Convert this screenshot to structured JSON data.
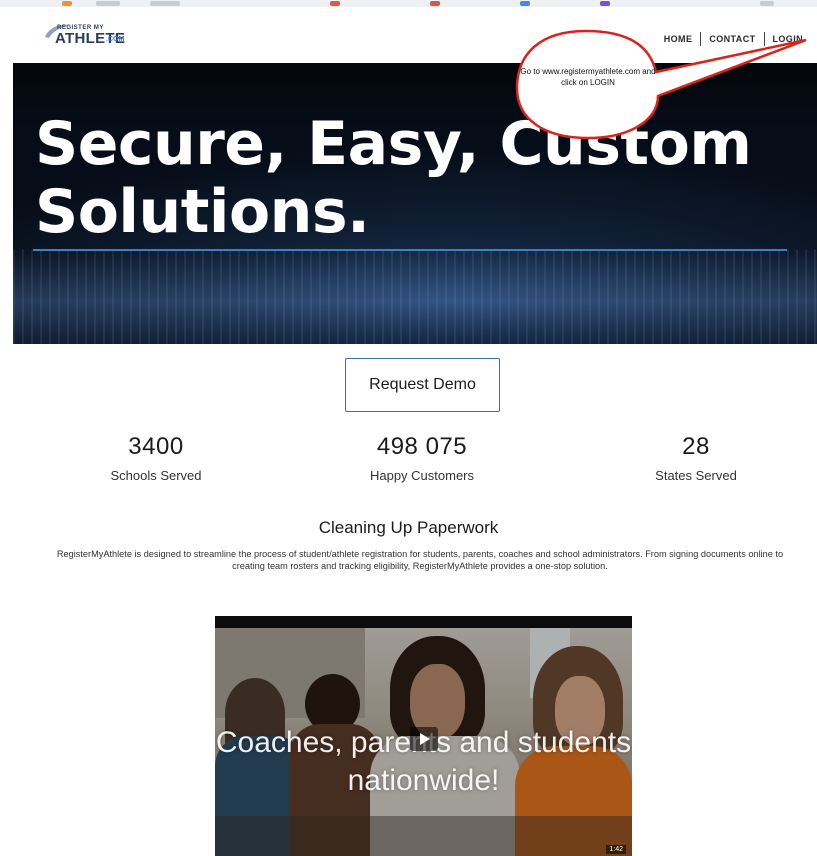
{
  "header": {
    "logo": {
      "top": "REGISTER MY",
      "main": "ATHLETE",
      "suffix": ".COM"
    },
    "nav": [
      {
        "label": "HOME"
      },
      {
        "label": "CONTACT"
      },
      {
        "label": "LOGIN"
      }
    ]
  },
  "hero": {
    "headline": "Secure, Easy, Custom Solutions."
  },
  "callout": {
    "text": "Go to www.registermyathlete.com and click on LOGIN",
    "color": "#d8241c"
  },
  "demo_button": {
    "label": "Request Demo"
  },
  "stats": [
    {
      "value": "3400",
      "label": "Schools Served"
    },
    {
      "value": "498 075",
      "label": "Happy Customers"
    },
    {
      "value": "28",
      "label": "States Served"
    }
  ],
  "about": {
    "title": "Cleaning Up Paperwork",
    "text": "RegisterMyAthlete is designed to streamline the process of student/athlete registration for students, parents, coaches and school administrators. From signing documents online to creating team rosters and tracking eligibility, RegisterMyAthlete provides a one-stop solution."
  },
  "video": {
    "caption": "Coaches, parents and students nationwide!",
    "duration": "1:42"
  },
  "colors": {
    "accent": "#3d6fa8",
    "hero_rule": "#3f7fc2"
  }
}
